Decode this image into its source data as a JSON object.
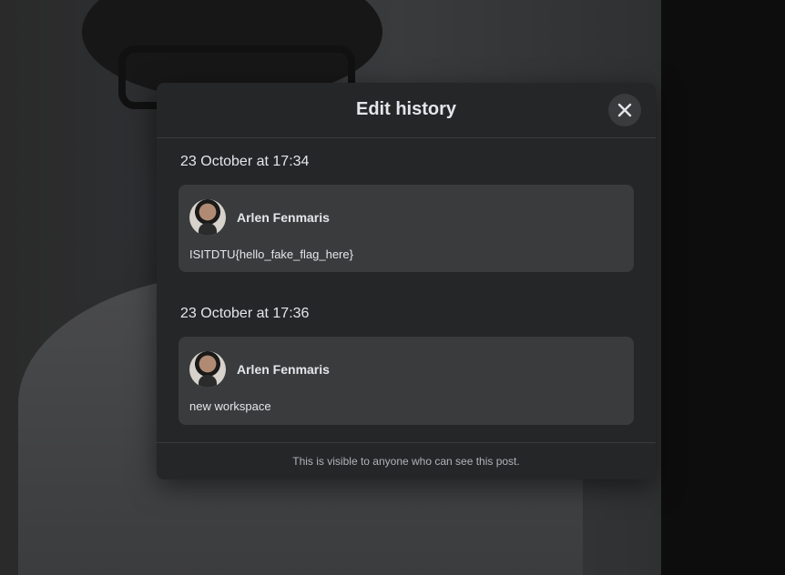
{
  "modal": {
    "title": "Edit history",
    "close_icon": "close-icon",
    "footer": "This is visible to anyone who can see this post."
  },
  "entries": [
    {
      "date": "23 October at 17:34",
      "author": "Arlen Fenmaris",
      "content": "ISITDTU{hello_fake_flag_here}"
    },
    {
      "date": "23 October at 17:36",
      "author": "Arlen Fenmaris",
      "content": "new workspace"
    }
  ],
  "colors": {
    "modal_bg": "#252628",
    "card_bg": "#3a3b3c",
    "text": "#e4e6eb",
    "muted_text": "#b0b3b8"
  }
}
